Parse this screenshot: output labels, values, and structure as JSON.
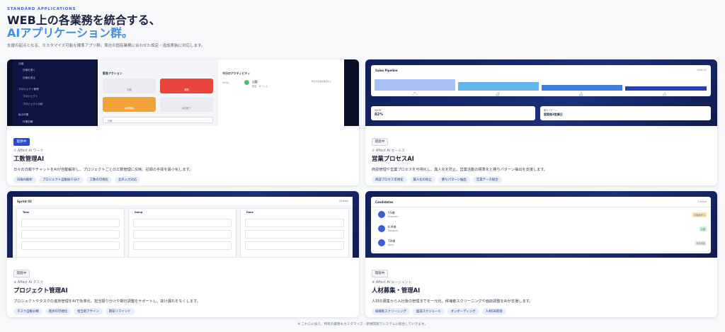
{
  "header": {
    "eyebrow": "STANDARD APPLICATIONS",
    "title_line1": "WEB上の各業務を統合する、",
    "title_line2": "AIアプリケーション群。",
    "lead": "支援の起点となる、カスタマイズ可能な標準アプリ群。貴社の固有業務に合わせた設定・追加実装に対応します。"
  },
  "cards": [
    {
      "badge": "提供中",
      "subtitle": "① Affect AI ワーク",
      "title": "工数管理AI",
      "desc": "日々の日報やチャットをAIが自動解析し、プロジェクトごとの工数管理に反映。記録の手間を最小化します。",
      "tags": [
        "日報AI解析",
        "プロジェクト自動振り分け",
        "工数の可視化",
        "音声入力対応"
      ]
    },
    {
      "badge": "開発中",
      "subtitle": "② Affect AI セールス",
      "title": "営業プロセスAI",
      "desc": "商談管理や営業プロセスを可視化し、属人化を防止。営業活動の標準化と勝ちパターン抽出を支援します。",
      "tags": [
        "商談プロセス可視化",
        "属人化の防止",
        "勝ちパターン抽出",
        "営業データ統合"
      ]
    },
    {
      "badge": "開発中",
      "subtitle": "③ Affect AI タスク",
      "title": "プロジェクト管理AI",
      "desc": "プロジェクトやタスクの進捗管理をAIで効率化。担当振り分けや期日調整をサポートし、抜け漏れをなくします。",
      "tags": [
        "タスク自動分類",
        "進捗の可視化",
        "担当者アサイン",
        "期日リマインド"
      ]
    },
    {
      "badge": "開発中",
      "subtitle": "④ Affect AI エージェント",
      "title": "人材募集・管理AI",
      "desc": "人材の募集から入社後の管理までを一元化。候補者スクリーニングや面談調整をAIが支援します。",
      "tags": [
        "候補者スクリーニング",
        "面談スケジュール",
        "オンボーディング",
        "人材DB管理"
      ]
    }
  ],
  "mock1": {
    "sidebar": [
      "日報",
      "日報を書く",
      "日報を見る",
      "プロジェクト管理",
      "プロジェクト",
      "プロジェクト分析",
      "私の作業",
      "作業依頼"
    ],
    "quick_title": "緊急アクション",
    "quick_btns": [
      "日報",
      "退勤",
      "休憩開始",
      "休憩終了"
    ],
    "select": "日報",
    "activity_title": "今日のアクティビティ",
    "activity_time": "09:00",
    "activity_name": "出勤",
    "activity_sub": "勤怠・オフィス",
    "activity_note": "昨日の日報を確認する"
  },
  "mock2": {
    "title": "Sales Pipeline",
    "date": "2026 Q2",
    "stages": [
      {
        "v": "24",
        "l": "リード"
      },
      {
        "v": "12",
        "l": "商談"
      },
      {
        "v": "8",
        "l": "提案"
      },
      {
        "v": "4",
        "l": "受注"
      }
    ],
    "stat1_label": "成約率",
    "stat1_value": "82%",
    "stat2_label": "勝ちパターン",
    "stat2_value": "提案後3営業日"
  },
  "mock3": {
    "title": "Sprint 02",
    "count": "16 tasks",
    "cols": [
      "Todo",
      "Doing",
      "Done"
    ]
  },
  "mock4": {
    "title": "Candidates",
    "count": "3 active",
    "people": [
      {
        "n": "Y.S様",
        "r": "Engineer",
        "s": "書類選考中"
      },
      {
        "n": "K.M様",
        "r": "Designer",
        "s": "合格"
      },
      {
        "n": "T.N様",
        "r": "Sales",
        "s": "面接調整"
      }
    ]
  },
  "footer": "※ これらに加え、特有の業務もカスタマイズ・新規開発でシステムに統合していきます。",
  "colors": {
    "accent": "#2b4bd7",
    "navy": "#10205a",
    "red": "#e8453f",
    "orange": "#f1a33a"
  }
}
